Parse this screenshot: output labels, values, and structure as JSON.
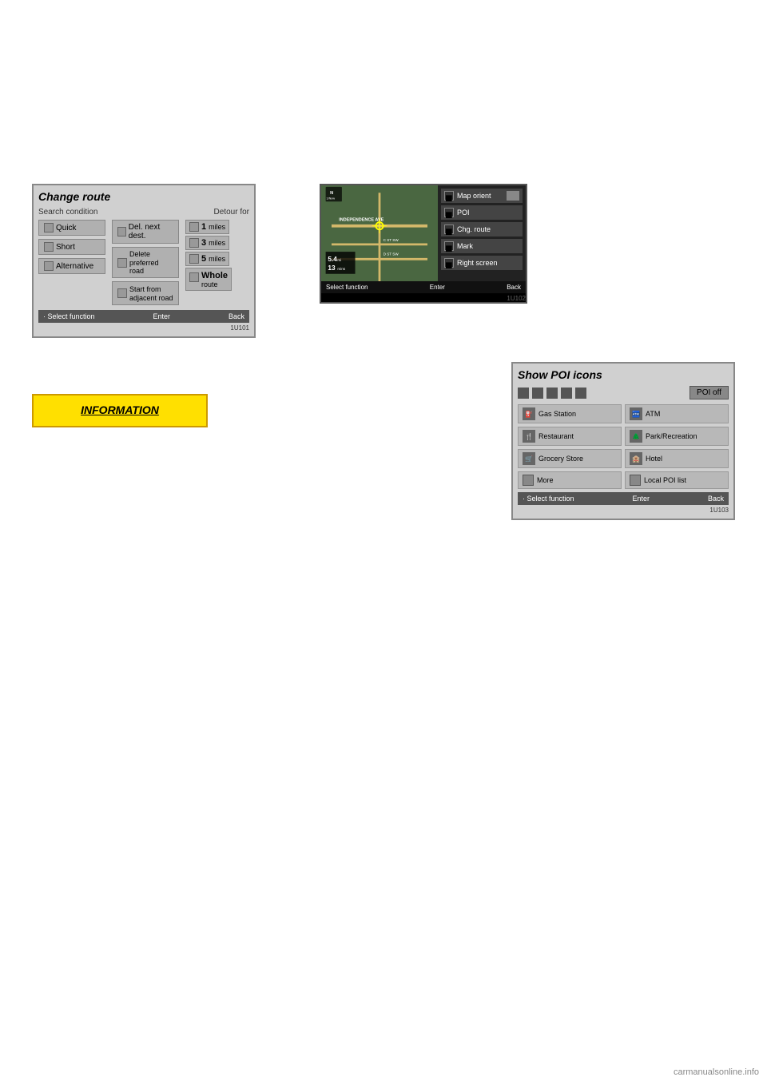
{
  "page": {
    "background": "#ffffff",
    "watermark": "carmanualsonline.info"
  },
  "changeRouteScreen": {
    "title": "Change route",
    "searchConditionLabel": "Search condition",
    "detourForLabel": "Detour for",
    "options": {
      "quick": "Quick",
      "short": "Short",
      "alternative": "Alternative",
      "delNextDest": "Del. next dest.",
      "deletePreferredRoad": "Delete\npreferred road",
      "startFromAdjacentRoad": "Start from\nadjacent road",
      "deletePreferredLine1": "Delete",
      "deletePreferredLine2": "preferred road",
      "startFromLine1": "Start from",
      "startFromLine2": "adjacent road"
    },
    "detourOptions": [
      {
        "value": "1",
        "unit": "miles"
      },
      {
        "value": "3",
        "unit": "miles"
      },
      {
        "value": "5",
        "unit": "miles"
      },
      {
        "value": "Whole",
        "unit": "route"
      }
    ],
    "bottomBar": {
      "selectFunction": "· Select function",
      "enter": "Enter",
      "back": "Back"
    },
    "screenId": "1U101"
  },
  "mapMenuScreen": {
    "northLabel": "N\n1/Now",
    "roadLabel": "INDEPENDENCE AVE",
    "roadLabel2": "C ST SW",
    "roadLabel3": "D ST SW",
    "distanceValue": "5.4",
    "distanceUnit": "mi",
    "timeValue": "13",
    "timeUnit": "mins",
    "menuItems": [
      {
        "label": "Map orient",
        "hasIcon": true
      },
      {
        "label": "POI",
        "hasIcon": false
      },
      {
        "label": "Chg. route",
        "hasIcon": false
      },
      {
        "label": "Mark",
        "hasIcon": false
      },
      {
        "label": "Right screen",
        "hasIcon": false
      }
    ],
    "bottomBar": {
      "selectFunction": "Select function",
      "enter": "Enter",
      "back": "Back"
    },
    "screenId": "1U102"
  },
  "informationBox": {
    "label": "INFORMATION"
  },
  "poiScreen": {
    "title": "Show POI icons",
    "poiOffLabel": "POI off",
    "iconLabels": [
      "■",
      "■",
      "■",
      "■",
      "■"
    ],
    "items": [
      {
        "label": "Gas Station",
        "hasIcon": true,
        "iconText": "⛽"
      },
      {
        "label": "ATM",
        "hasIcon": true,
        "iconText": "🏧"
      },
      {
        "label": "Restaurant",
        "hasIcon": true,
        "iconText": "🍴"
      },
      {
        "label": "Park/Recreation",
        "hasIcon": true,
        "iconText": "🌲"
      },
      {
        "label": "Grocery Store",
        "hasIcon": true,
        "iconText": "🛒"
      },
      {
        "label": "Hotel",
        "hasIcon": true,
        "iconText": "🏨"
      },
      {
        "label": "More",
        "hasIcon": false
      },
      {
        "label": "Local POI list",
        "hasIcon": false
      }
    ],
    "bottomBar": {
      "selectFunction": "· Select function",
      "enter": "Enter",
      "back": "Back"
    },
    "screenId": "1U103"
  }
}
